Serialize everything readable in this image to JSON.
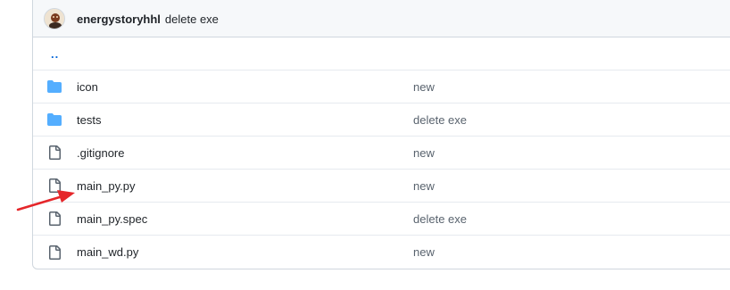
{
  "commit": {
    "author": "energystoryhhl",
    "message": "delete exe"
  },
  "parent_link": "..",
  "files": [
    {
      "name": "icon",
      "type": "folder",
      "message": "new"
    },
    {
      "name": "tests",
      "type": "folder",
      "message": "delete exe"
    },
    {
      "name": ".gitignore",
      "type": "file",
      "message": "new"
    },
    {
      "name": "main_py.py",
      "type": "file",
      "message": "new"
    },
    {
      "name": "main_py.spec",
      "type": "file",
      "message": "delete exe"
    },
    {
      "name": "main_wd.py",
      "type": "file",
      "message": "new"
    }
  ],
  "colors": {
    "folder": "#54aeff",
    "file_icon": "#59636e",
    "annotation_arrow": "#e5262a",
    "link": "#0969da"
  },
  "icons": {
    "folder": "folder-icon",
    "file": "file-icon"
  }
}
